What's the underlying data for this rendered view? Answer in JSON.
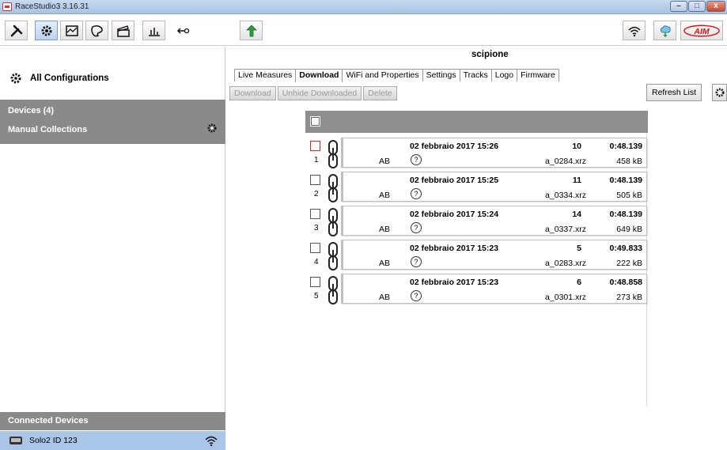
{
  "window": {
    "title": "RaceStudio3 3.16.31",
    "min": "–",
    "max": "□",
    "close": "x"
  },
  "toolbar": {
    "left": [
      "wrench-icon",
      "settings-icon",
      "analysis-icon",
      "track-icon",
      "clapper-icon",
      "chart-icon",
      "import-icon"
    ],
    "download_icon": "download-arrow-icon",
    "right": [
      "wifi-icon",
      "cloud-icon",
      "aim-logo"
    ],
    "logo_text": "AIM"
  },
  "sidebar": {
    "all_configurations": "All Configurations",
    "devices": "Devices  (4)",
    "manual_collections": "Manual Collections",
    "connected_devices": "Connected Devices",
    "device_name": "Solo2 ID 123"
  },
  "main": {
    "device_title": "scipione",
    "tabs": [
      "Live Measures",
      "Download",
      "WiFi and Properties",
      "Settings",
      "Tracks",
      "Logo",
      "Firmware"
    ],
    "active_tab": "Download",
    "actions": {
      "download": "Download",
      "unhide": "Unhide Downloaded",
      "delete": "Delete"
    },
    "refresh": "Refresh List"
  },
  "sessions": [
    {
      "index": "1",
      "date": "02 febbraio 2017 15:26",
      "laps": "10",
      "best": "0:48.139",
      "driver": "AB",
      "file": "a_0284.xrz",
      "size": "458 kB"
    },
    {
      "index": "2",
      "date": "02 febbraio 2017 15:25",
      "laps": "11",
      "best": "0:48.139",
      "driver": "AB",
      "file": "a_0334.xrz",
      "size": "505 kB"
    },
    {
      "index": "3",
      "date": "02 febbraio 2017 15:24",
      "laps": "14",
      "best": "0:48.139",
      "driver": "AB",
      "file": "a_0337.xrz",
      "size": "649 kB"
    },
    {
      "index": "4",
      "date": "02 febbraio 2017 15:23",
      "laps": "5",
      "best": "0:49.833",
      "driver": "AB",
      "file": "a_0283.xrz",
      "size": "222 kB"
    },
    {
      "index": "5",
      "date": "02 febbraio 2017 15:23",
      "laps": "6",
      "best": "0:48.858",
      "driver": "AB",
      "file": "a_0301.xrz",
      "size": "273 kB"
    }
  ],
  "colors": {
    "band": "#8a8a8a",
    "selected_device": "#a9c6e8",
    "first_check": "#d22222"
  }
}
